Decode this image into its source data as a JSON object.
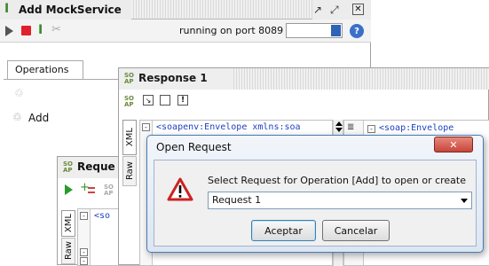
{
  "mock_window": {
    "title": "Add MockService",
    "status": "running on port 8089",
    "tab_operations": "Operations",
    "operation_item": "Add"
  },
  "response_window": {
    "title": "Response 1",
    "tab_xml": "XML",
    "tab_raw": "Raw",
    "xml_line_left": "<soapenv:Envelope xmlns:soa",
    "xml_line_right": "<soap:Envelope"
  },
  "request_window": {
    "title": "Reque",
    "tab_xml": "XML",
    "tab_raw": "Raw",
    "xml_line": "<so"
  },
  "dialog": {
    "title": "Open Request",
    "message": "Select Request for Operation [Add] to open or create",
    "selected": "Request 1",
    "ok_label": "Aceptar",
    "cancel_label": "Cancelar"
  },
  "icons": {
    "soapui_badge": "SO AP"
  },
  "colors": {
    "dialog_border": "#4a7ab8",
    "close_red": "#c7463b",
    "progress_blue": "#2f63b8",
    "warning_red": "#cc2222"
  }
}
